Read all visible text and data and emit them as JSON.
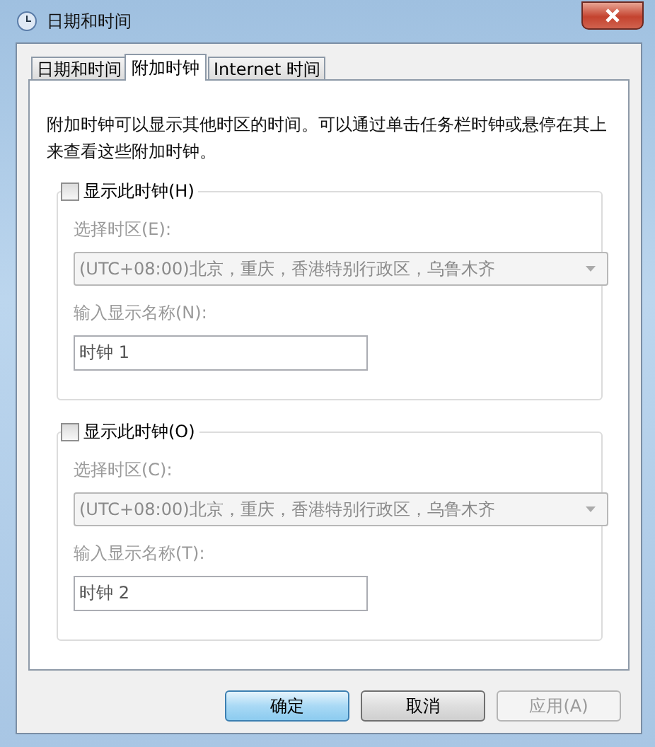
{
  "window": {
    "title": "日期和时间"
  },
  "tabs": [
    {
      "label": "日期和时间",
      "selected": false
    },
    {
      "label": "附加时钟",
      "selected": true
    },
    {
      "label": "Internet 时间",
      "selected": false
    }
  ],
  "description": "附加时钟可以显示其他时区的时间。可以通过单击任务栏时钟或悬停在其上来查看这些附加时钟。",
  "clocks": [
    {
      "checkbox_label": "显示此时钟(H)",
      "checked": false,
      "timezone_label": "选择时区(E):",
      "timezone": "(UTC+08:00)北京，重庆，香港特别行政区，乌鲁木齐",
      "name_label": "输入显示名称(N):",
      "name": "时钟 1"
    },
    {
      "checkbox_label": "显示此时钟(O)",
      "checked": false,
      "timezone_label": "选择时区(C):",
      "timezone": "(UTC+08:00)北京，重庆，香港特别行政区，乌鲁木齐",
      "name_label": "输入显示名称(T):",
      "name": "时钟 2"
    }
  ],
  "buttons": [
    {
      "label": "确定",
      "disabled": false,
      "default": true
    },
    {
      "label": "取消",
      "disabled": false,
      "default": false
    },
    {
      "label": "应用(A)",
      "disabled": true,
      "default": false
    }
  ]
}
